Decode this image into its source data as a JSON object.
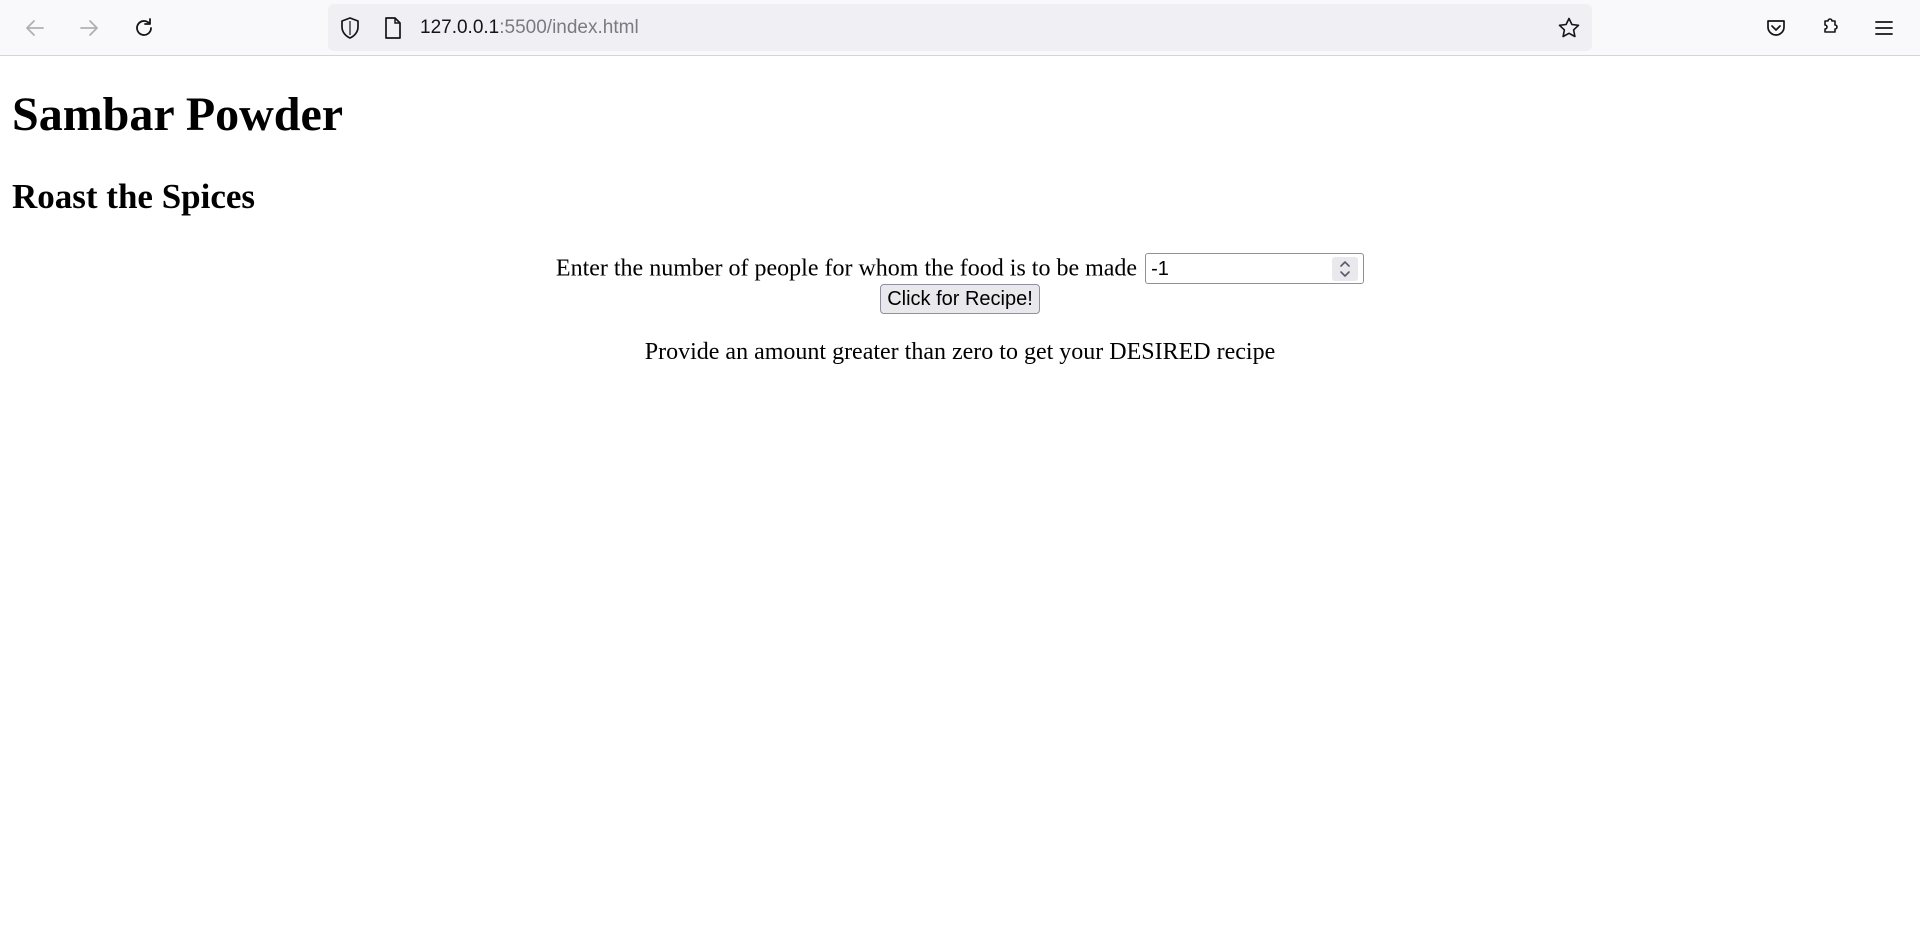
{
  "browser": {
    "url_host": "127.0.0.1",
    "url_path": ":5500/index.html",
    "icons": [
      "back-arrow-icon",
      "forward-arrow-icon",
      "reload-icon",
      "shield-icon",
      "page-icon",
      "star-icon",
      "pocket-icon",
      "extensions-icon",
      "menu-icon"
    ]
  },
  "page": {
    "title": "Sambar Powder",
    "subtitle": "Roast the Spices",
    "form": {
      "label": "Enter the number of people for whom the food is to be made",
      "input_value": "-1",
      "button_label": "Click for Recipe!"
    },
    "message": "Provide an amount greater than zero to get your DESIRED recipe"
  },
  "colors": {
    "toolbar_bg": "#f9f9fb",
    "urlbar_bg": "#f0f0f4",
    "button_bg": "#e9e9ed",
    "url_path_color": "#7b7a80"
  }
}
